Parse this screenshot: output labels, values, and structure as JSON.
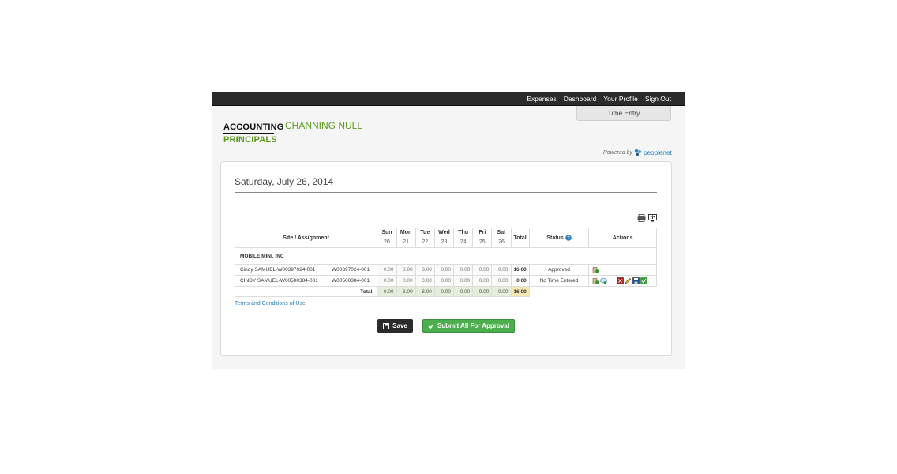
{
  "nav": {
    "items": [
      "Expenses",
      "Dashboard",
      "Your Profile",
      "Sign Out"
    ]
  },
  "tab": {
    "label": "Time Entry"
  },
  "logo": {
    "line1": "ACCOUNTING",
    "line2": "PRINCIPALS"
  },
  "user": {
    "name": "CHANNING NULL"
  },
  "powered": {
    "prefix": "Powered by",
    "brand": "peoplenet"
  },
  "page": {
    "date": "Saturday, July 26, 2014"
  },
  "table": {
    "site_header": "Site / Assignment",
    "days": [
      {
        "label": "Sun",
        "num": "20"
      },
      {
        "label": "Mon",
        "num": "21"
      },
      {
        "label": "Tue",
        "num": "22"
      },
      {
        "label": "Wed",
        "num": "23"
      },
      {
        "label": "Thu",
        "num": "24"
      },
      {
        "label": "Fri",
        "num": "25"
      },
      {
        "label": "Sat",
        "num": "26"
      }
    ],
    "total_header": "Total",
    "status_header": "Status",
    "actions_header": "Actions",
    "customer": "MOBILE MINI, INC",
    "rows": [
      {
        "name": "Cindy SAMUEL-W00397024-001",
        "order": "W00397024-001",
        "hours": [
          "0.00",
          "8.00",
          "8.00",
          "0.00",
          "0.00",
          "0.00",
          "0.00"
        ],
        "total": "16.00",
        "status": "Approved"
      },
      {
        "name": "CINDY SAMUEL-W00500384-001",
        "order": "W00500384-001",
        "hours": [
          "0.00",
          "0.00",
          "0.00",
          "0.00",
          "0.00",
          "0.00",
          "0.00"
        ],
        "total": "0.00",
        "status": "No Time Entered"
      }
    ],
    "totals_label": "Total",
    "totals": [
      "0.00",
      "8.00",
      "8.00",
      "0.00",
      "0.00",
      "0.00",
      "0.00"
    ],
    "grand_total": "16.00"
  },
  "links": {
    "terms": "Terms and Conditions of Use"
  },
  "buttons": {
    "save": "Save",
    "submit": "Submit All For Approval"
  },
  "icons": {
    "print": "printer-icon",
    "export": "monitor-export-icon",
    "help": "question-circle-icon",
    "notes": "clipboard-icon",
    "comments": "comment-icon",
    "delete": "delete-icon",
    "edit": "pencil-icon",
    "save": "floppy-icon",
    "approve": "checkmark-icon"
  },
  "colors": {
    "brand_green": "#5c9a1f",
    "topbar": "#2b2b2b",
    "link_blue": "#2a7fbf",
    "submit_green": "#4cae4c"
  }
}
